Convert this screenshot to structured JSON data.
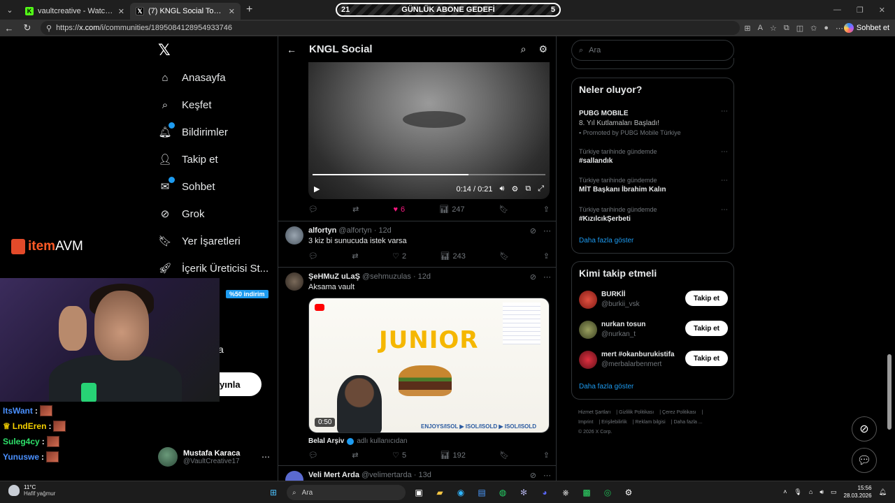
{
  "browser": {
    "tabs": [
      {
        "title": "vaultcreative - Watch the VOD on",
        "favicon": "kick-icon",
        "color": "#53fc18",
        "letter": "K"
      },
      {
        "title": "(7) KNGL Social Topluluk / X",
        "favicon": "x-icon",
        "color": "#000000",
        "letter": "𝕏"
      }
    ],
    "goal": {
      "left": "21",
      "label": "GÜNLÜK ABONE GEDEFİ",
      "right": "5"
    },
    "url_prefix": "https://",
    "url_host": "x.com",
    "url_path": "/i/communities/1895084128954933746",
    "sohbet_label": "Sohbet et"
  },
  "x_nav": {
    "items": [
      {
        "label": "Anasayfa",
        "icon": "home-icon",
        "glyph": "⌂"
      },
      {
        "label": "Keşfet",
        "icon": "search-icon",
        "glyph": "⌕"
      },
      {
        "label": "Bildirimler",
        "icon": "bell-icon",
        "glyph": "🔔︎",
        "badge": true
      },
      {
        "label": "Takip et",
        "icon": "person-plus-icon",
        "glyph": "👤︎"
      },
      {
        "label": "Sohbet",
        "icon": "mail-icon",
        "glyph": "✉",
        "badge": true
      },
      {
        "label": "Grok",
        "icon": "grok-icon",
        "glyph": "⊘"
      },
      {
        "label": "Yer İşaretleri",
        "icon": "bookmark-icon",
        "glyph": "🔖︎"
      },
      {
        "label": "İçerik Üreticisi St...",
        "icon": "rocket-icon",
        "glyph": "🚀︎"
      }
    ],
    "discount": "%50 indirim",
    "fragment_a": "a",
    "post_button_fragment": "yınla",
    "account": {
      "name": "Mustafa Karaca",
      "handle": "@VaultCreative17"
    }
  },
  "overlay": {
    "brand_a": "item",
    "brand_b": "AVM",
    "chat": [
      {
        "user": "ItsWant",
        "color": "#4a90ff",
        "prefix": ""
      },
      {
        "user": "LndEren",
        "color": "#f5d000",
        "prefix": "👑 "
      },
      {
        "user": "Suleg4cy",
        "color": "#2ee06a",
        "prefix": ""
      },
      {
        "user": "Yunuswe",
        "color": "#4a90ff",
        "prefix": ""
      }
    ]
  },
  "center": {
    "title": "KNGL Social",
    "video1": {
      "time": "0:14 / 0:21",
      "progress": 0.67
    },
    "post1_actions": {
      "likes": "6",
      "views": "247"
    },
    "post2": {
      "name": "alforty​n",
      "handle": "@alfortyn",
      "age": "· 12d",
      "text": "3 kiz bi sunucuda istek varsa",
      "likes": "2",
      "views": "243"
    },
    "post3": {
      "name": "ŞeHMuZ uLaŞ",
      "handle": "@sehmuzulas",
      "age": "· 12d",
      "text": "Aksama vault",
      "video_title": "JUNIOR",
      "video_duration": "0:50",
      "video_caption": "ENJOYS/ISOL ▶ ISOL/ISOLD ▶ ISOL/ISOLD",
      "attribution_name": "Belal Arşiv",
      "attribution_by": "adlı kullanıcıdan",
      "likes": "5",
      "views": "192"
    },
    "post4": {
      "name": "Veli Mert Arda",
      "handle": "@velimertarda",
      "age": "· 13d"
    }
  },
  "right": {
    "search_placeholder": "Ara",
    "trends_title": "Neler oluyor?",
    "trends": [
      {
        "context": "",
        "name": "PUBG MOBILE",
        "sub": "8. Yıl Kutlamaları Başladı!",
        "promo": "Promoted by PUBG Mobile Türkiye"
      },
      {
        "context": "Türkiye tarihinde gündemde",
        "name": "#sallandık"
      },
      {
        "context": "Türkiye tarihinde gündemde",
        "name": "MİT Başkanı İbrahim Kalın"
      },
      {
        "context": "Türkiye tarihinde gündemde",
        "name": "#KızılcıkŞerbeti"
      }
    ],
    "show_more": "Daha fazla göster",
    "who_title": "Kimi takip etmeli",
    "who": [
      {
        "name": "BURKİİ",
        "handle": "@burkii_vsk",
        "color": "#c0392b"
      },
      {
        "name": "nurkan tosun",
        "handle": "@nurkan_t",
        "color": "#6b7a3a"
      },
      {
        "name": "mert #okanburukistifa",
        "handle": "@merbalarbenmert",
        "color": "#b0202a"
      }
    ],
    "follow_label": "Takip et",
    "footer": [
      "Hizmet Şartları",
      "Gizlilik Politikası",
      "Çerez Politikası",
      "Imprint",
      "Erişilebilirlik",
      "Reklam bilgisi",
      "Daha fazla ...",
      "© 2026 X Corp."
    ]
  },
  "taskbar": {
    "temp": "11°C",
    "weather": "Hafif yağmur",
    "search": "Ara",
    "time": "15:56",
    "date": "28.03.2026"
  }
}
